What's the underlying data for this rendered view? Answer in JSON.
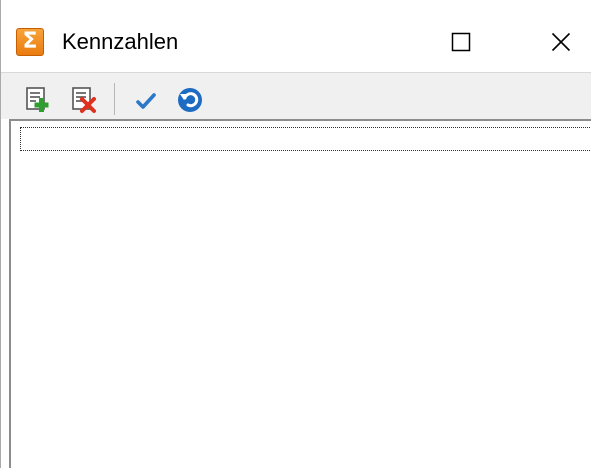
{
  "window": {
    "title": "Kennzahlen",
    "app_icon_glyph": "Σ",
    "app_icon": "sigma-icon",
    "accent_color": "#ea7c10"
  },
  "controls": {
    "maximize": "maximize-icon",
    "close": "close-icon"
  },
  "toolbar": {
    "items": [
      {
        "icon": "add-record-icon",
        "accent_color": "#2e9e2e"
      },
      {
        "icon": "delete-record-icon",
        "accent_color": "#e0301e"
      },
      {
        "icon": "checkmark-icon",
        "accent_color": "#2a78c8"
      },
      {
        "icon": "undo-icon",
        "accent_color": "#1e6bc4"
      }
    ]
  },
  "list": {
    "rows": []
  }
}
